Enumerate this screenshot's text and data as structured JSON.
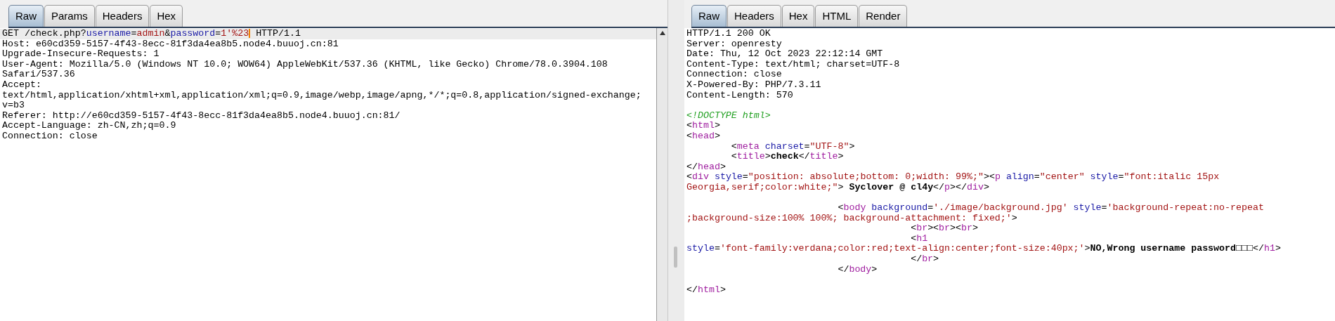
{
  "request_panel": {
    "tabs": [
      {
        "label": "Raw",
        "selected": true
      },
      {
        "label": "Params",
        "selected": false
      },
      {
        "label": "Headers",
        "selected": false
      },
      {
        "label": "Hex",
        "selected": false
      }
    ],
    "lines": [
      {
        "kind": "text",
        "highlighted": true,
        "segments": [
          {
            "kind": "plain",
            "text": "GET /check.php?"
          },
          {
            "kind": "name",
            "text": "username"
          },
          {
            "kind": "plain",
            "text": "="
          },
          {
            "kind": "value",
            "text": "admin"
          },
          {
            "kind": "plain",
            "text": "&"
          },
          {
            "kind": "name",
            "text": "password"
          },
          {
            "kind": "plain",
            "text": "="
          },
          {
            "kind": "value",
            "text": "1'%23",
            "caret": true
          },
          {
            "kind": "plain",
            "text": " HTTP/1.1"
          }
        ]
      },
      {
        "kind": "text",
        "highlighted": false,
        "segments": [
          {
            "kind": "plain",
            "text": "Host: e60cd359-5157-4f43-8ecc-81f3da4ea8b5.node4.buuoj.cn:81"
          }
        ]
      },
      {
        "kind": "text",
        "highlighted": false,
        "segments": [
          {
            "kind": "plain",
            "text": "Upgrade-Insecure-Requests: 1"
          }
        ]
      },
      {
        "kind": "text",
        "highlighted": false,
        "segments": [
          {
            "kind": "plain",
            "text": "User-Agent: Mozilla/5.0 (Windows NT 10.0; WOW64) AppleWebKit/537.36 (KHTML, like Gecko) Chrome/78.0.3904.108"
          }
        ]
      },
      {
        "kind": "text",
        "highlighted": false,
        "segments": [
          {
            "kind": "plain",
            "text": "Safari/537.36"
          }
        ]
      },
      {
        "kind": "text",
        "highlighted": false,
        "segments": [
          {
            "kind": "plain",
            "text": "Accept:"
          }
        ]
      },
      {
        "kind": "text",
        "highlighted": false,
        "segments": [
          {
            "kind": "plain",
            "text": "text/html,application/xhtml+xml,application/xml;q=0.9,image/webp,image/apng,*/*;q=0.8,application/signed-exchange;"
          }
        ]
      },
      {
        "kind": "text",
        "highlighted": false,
        "segments": [
          {
            "kind": "plain",
            "text": "v=b3"
          }
        ]
      },
      {
        "kind": "text",
        "highlighted": false,
        "segments": [
          {
            "kind": "plain",
            "text": "Referer: http://e60cd359-5157-4f43-8ecc-81f3da4ea8b5.node4.buuoj.cn:81/"
          }
        ]
      },
      {
        "kind": "text",
        "highlighted": false,
        "segments": [
          {
            "kind": "plain",
            "text": "Accept-Language: zh-CN,zh;q=0.9"
          }
        ]
      },
      {
        "kind": "text",
        "highlighted": false,
        "segments": [
          {
            "kind": "plain",
            "text": "Connection: close"
          }
        ]
      }
    ]
  },
  "response_panel": {
    "tabs": [
      {
        "label": "Raw",
        "selected": true
      },
      {
        "label": "Headers",
        "selected": false
      },
      {
        "label": "Hex",
        "selected": false
      },
      {
        "label": "HTML",
        "selected": false
      },
      {
        "label": "Render",
        "selected": false
      }
    ],
    "lines": [
      {
        "kind": "text",
        "highlighted": false,
        "segments": [
          {
            "kind": "plain",
            "text": "HTTP/1.1 200 OK"
          }
        ]
      },
      {
        "kind": "text",
        "highlighted": false,
        "segments": [
          {
            "kind": "plain",
            "text": "Server: openresty"
          }
        ]
      },
      {
        "kind": "text",
        "highlighted": false,
        "segments": [
          {
            "kind": "plain",
            "text": "Date: Thu, 12 Oct 2023 22:12:14 GMT"
          }
        ]
      },
      {
        "kind": "text",
        "highlighted": false,
        "segments": [
          {
            "kind": "plain",
            "text": "Content-Type: text/html; charset=UTF-8"
          }
        ]
      },
      {
        "kind": "text",
        "highlighted": false,
        "segments": [
          {
            "kind": "plain",
            "text": "Connection: close"
          }
        ]
      },
      {
        "kind": "text",
        "highlighted": false,
        "segments": [
          {
            "kind": "plain",
            "text": "X-Powered-By: PHP/7.3.11"
          }
        ]
      },
      {
        "kind": "text",
        "highlighted": false,
        "segments": [
          {
            "kind": "plain",
            "text": "Content-Length: 570"
          }
        ]
      },
      {
        "kind": "blank"
      },
      {
        "kind": "text",
        "highlighted": false,
        "segments": [
          {
            "kind": "doctype",
            "text": "<!DOCTYPE html>"
          }
        ]
      },
      {
        "kind": "text",
        "highlighted": false,
        "segments": [
          {
            "kind": "plain",
            "text": "<"
          },
          {
            "kind": "tag",
            "text": "html"
          },
          {
            "kind": "plain",
            "text": ">"
          }
        ]
      },
      {
        "kind": "text",
        "highlighted": false,
        "segments": [
          {
            "kind": "plain",
            "text": "<"
          },
          {
            "kind": "tag",
            "text": "head"
          },
          {
            "kind": "plain",
            "text": ">"
          }
        ]
      },
      {
        "kind": "text",
        "highlighted": false,
        "segments": [
          {
            "kind": "plain",
            "text": "        <"
          },
          {
            "kind": "tag",
            "text": "meta"
          },
          {
            "kind": "attr",
            "text": " charset"
          },
          {
            "kind": "plain",
            "text": "="
          },
          {
            "kind": "string",
            "text": "\"UTF-8\""
          },
          {
            "kind": "plain",
            "text": ">"
          }
        ]
      },
      {
        "kind": "text",
        "highlighted": false,
        "segments": [
          {
            "kind": "plain",
            "text": "        <"
          },
          {
            "kind": "tag",
            "text": "title"
          },
          {
            "kind": "plain",
            "text": ">"
          },
          {
            "kind": "bold",
            "text": "check"
          },
          {
            "kind": "plain",
            "text": "</"
          },
          {
            "kind": "tag",
            "text": "title"
          },
          {
            "kind": "plain",
            "text": ">"
          }
        ]
      },
      {
        "kind": "text",
        "highlighted": false,
        "segments": [
          {
            "kind": "plain",
            "text": "</"
          },
          {
            "kind": "tag",
            "text": "head"
          },
          {
            "kind": "plain",
            "text": ">"
          }
        ]
      },
      {
        "kind": "text",
        "highlighted": false,
        "segments": [
          {
            "kind": "plain",
            "text": "<"
          },
          {
            "kind": "tag",
            "text": "div"
          },
          {
            "kind": "attr",
            "text": " style"
          },
          {
            "kind": "plain",
            "text": "="
          },
          {
            "kind": "string",
            "text": "\"position: absolute;bottom: 0;width: 99%;\""
          },
          {
            "kind": "plain",
            "text": "><"
          },
          {
            "kind": "tag",
            "text": "p"
          },
          {
            "kind": "attr",
            "text": " align"
          },
          {
            "kind": "plain",
            "text": "="
          },
          {
            "kind": "string",
            "text": "\"center\""
          },
          {
            "kind": "attr",
            "text": " style"
          },
          {
            "kind": "plain",
            "text": "="
          },
          {
            "kind": "string",
            "text": "\"font:italic 15px"
          }
        ]
      },
      {
        "kind": "text",
        "highlighted": false,
        "segments": [
          {
            "kind": "string",
            "text": "Georgia,serif;color:white;\""
          },
          {
            "kind": "plain",
            "text": ">"
          },
          {
            "kind": "bold",
            "text": " Syclover @ cl4y"
          },
          {
            "kind": "plain",
            "text": "</"
          },
          {
            "kind": "tag",
            "text": "p"
          },
          {
            "kind": "plain",
            "text": "></"
          },
          {
            "kind": "tag",
            "text": "div"
          },
          {
            "kind": "plain",
            "text": ">"
          }
        ]
      },
      {
        "kind": "blank"
      },
      {
        "kind": "text",
        "highlighted": false,
        "segments": [
          {
            "kind": "plain",
            "text": "                           <"
          },
          {
            "kind": "tag",
            "text": "body"
          },
          {
            "kind": "attr",
            "text": " background"
          },
          {
            "kind": "plain",
            "text": "="
          },
          {
            "kind": "string",
            "text": "'./image/background.jpg'"
          },
          {
            "kind": "attr",
            "text": " style"
          },
          {
            "kind": "plain",
            "text": "="
          },
          {
            "kind": "string",
            "text": "'background-repeat:no-repeat"
          }
        ]
      },
      {
        "kind": "text",
        "highlighted": false,
        "segments": [
          {
            "kind": "string",
            "text": ";background-size:100% 100%; background-attachment: fixed;'"
          },
          {
            "kind": "plain",
            "text": ">"
          }
        ]
      },
      {
        "kind": "text",
        "highlighted": false,
        "segments": [
          {
            "kind": "plain",
            "text": "                                        <"
          },
          {
            "kind": "tag",
            "text": "br"
          },
          {
            "kind": "plain",
            "text": "><"
          },
          {
            "kind": "tag",
            "text": "br"
          },
          {
            "kind": "plain",
            "text": "><"
          },
          {
            "kind": "tag",
            "text": "br"
          },
          {
            "kind": "plain",
            "text": ">"
          }
        ]
      },
      {
        "kind": "text",
        "highlighted": false,
        "segments": [
          {
            "kind": "plain",
            "text": "                                        <"
          },
          {
            "kind": "tag",
            "text": "h1"
          }
        ]
      },
      {
        "kind": "text",
        "highlighted": false,
        "segments": [
          {
            "kind": "attr",
            "text": "style"
          },
          {
            "kind": "plain",
            "text": "="
          },
          {
            "kind": "string",
            "text": "'font-family:verdana;color:red;text-align:center;font-size:40px;'"
          },
          {
            "kind": "plain",
            "text": ">"
          },
          {
            "kind": "bold",
            "text": "NO,Wrong username password□□□"
          },
          {
            "kind": "plain",
            "text": "</"
          },
          {
            "kind": "tag",
            "text": "h1"
          },
          {
            "kind": "plain",
            "text": ">"
          }
        ]
      },
      {
        "kind": "text",
        "highlighted": false,
        "segments": [
          {
            "kind": "plain",
            "text": "                                        </"
          },
          {
            "kind": "tag",
            "text": "br"
          },
          {
            "kind": "plain",
            "text": ">"
          }
        ]
      },
      {
        "kind": "text",
        "highlighted": false,
        "segments": [
          {
            "kind": "plain",
            "text": "                           </"
          },
          {
            "kind": "tag",
            "text": "body"
          },
          {
            "kind": "plain",
            "text": ">"
          }
        ]
      },
      {
        "kind": "blank"
      },
      {
        "kind": "text",
        "highlighted": false,
        "segments": [
          {
            "kind": "plain",
            "text": "</"
          },
          {
            "kind": "tag",
            "text": "html"
          },
          {
            "kind": "plain",
            "text": ">"
          }
        ]
      }
    ]
  }
}
